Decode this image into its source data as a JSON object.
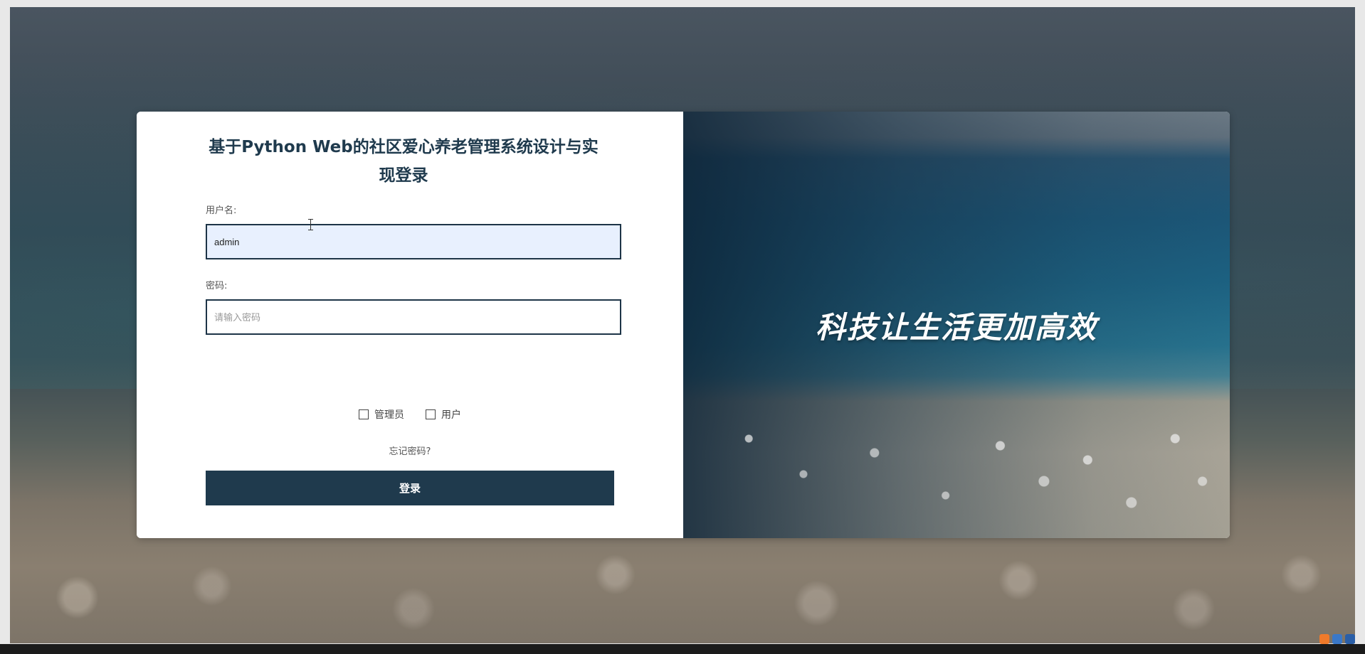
{
  "login": {
    "title": "基于Python Web的社区爱心养老管理系统设计与实现登录",
    "username_label": "用户名:",
    "username_value": "admin",
    "password_label": "密码:",
    "password_placeholder": "请输入密码",
    "roles": [
      {
        "label": "管理员",
        "checked": false
      },
      {
        "label": "用户",
        "checked": false
      }
    ],
    "forgot_password": "忘记密码?",
    "login_button": "登录"
  },
  "banner": {
    "slogan": "科技让生活更加高效"
  },
  "colors": {
    "primary": "#1f3a4d",
    "input_border": "#1d3447",
    "autofill_bg": "#e8f0fe"
  },
  "tray_icons": [
    "app-icon-orange",
    "app-icon-blue",
    "app-icon-chat"
  ]
}
